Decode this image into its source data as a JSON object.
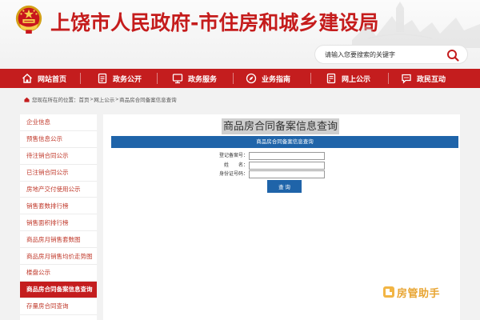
{
  "header": {
    "site_title": "上饶市人民政府-市住房和城乡建设局",
    "search_placeholder": "请输入您要搜索的关键字"
  },
  "nav": {
    "items": [
      {
        "label": "网站首页",
        "icon": "home-icon"
      },
      {
        "label": "政务公开",
        "icon": "document-icon"
      },
      {
        "label": "政务服务",
        "icon": "monitor-icon"
      },
      {
        "label": "业务指南",
        "icon": "compass-icon"
      },
      {
        "label": "网上公示",
        "icon": "notice-icon"
      },
      {
        "label": "政民互动",
        "icon": "chat-icon"
      }
    ]
  },
  "breadcrumb": {
    "prefix": "您现在所在的位置：",
    "home": "首页",
    "section": "网上公示",
    "current": "商品房合同备案信息查询"
  },
  "sidebar": {
    "items": [
      {
        "label": "企业信息",
        "active": false
      },
      {
        "label": "预售信息公示",
        "active": false
      },
      {
        "label": "待注销合同公示",
        "active": false
      },
      {
        "label": "已注销合同公示",
        "active": false
      },
      {
        "label": "房地产交付使用公示",
        "active": false
      },
      {
        "label": "销售套数排行榜",
        "active": false
      },
      {
        "label": "销售面积排行榜",
        "active": false
      },
      {
        "label": "商品房月销售套数图",
        "active": false
      },
      {
        "label": "商品房月销售均价走势图",
        "active": false
      },
      {
        "label": "楼盘公示",
        "active": false
      },
      {
        "label": "商品房合同备案信息查询",
        "active": true
      },
      {
        "label": "存量房合同查询",
        "active": false
      }
    ]
  },
  "main": {
    "title": "商品房合同备案信息查询",
    "form_header": "商品房合同备案信息查询",
    "fields": [
      {
        "label": "登记备案号：",
        "value": ""
      },
      {
        "label": "姓　　名：",
        "value": ""
      },
      {
        "label": "身份证号码：",
        "value": ""
      }
    ],
    "submit_label": "查 询"
  },
  "watermark": {
    "text": "房管助手"
  },
  "colors": {
    "brand_red": "#c41d1e",
    "form_blue": "#1f64a9",
    "watermark_orange": "#e8a533"
  }
}
